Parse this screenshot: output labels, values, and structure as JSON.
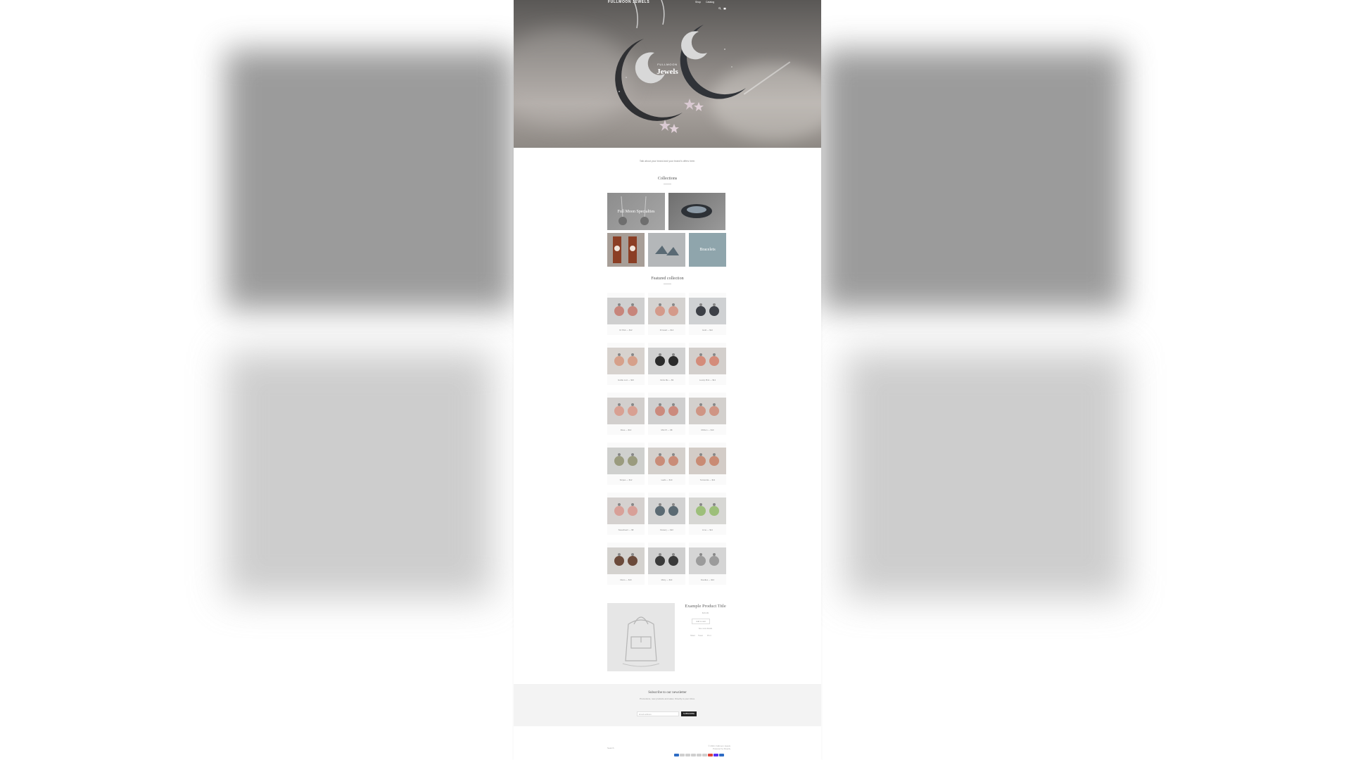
{
  "store": {
    "logo": "FULLMOON JEWELS",
    "nav_links": [
      "Shop",
      "Catalog"
    ],
    "hero_kicker": "FULLMOON",
    "hero_title": "Jewels",
    "intro_text": "Talk about your brand and your brand's offers here."
  },
  "collections": {
    "title": "Collections",
    "items": [
      "Full Moon Specialties",
      "",
      "",
      "",
      "Bracelets"
    ]
  },
  "featured": {
    "title": "Featured collection",
    "products": [
      {
        "name": "Dr Pink",
        "price": "$12"
      },
      {
        "name": "Dr Heart",
        "price": "$12"
      },
      {
        "name": "Gold",
        "price": "$12"
      },
      {
        "name": "Goldie Loci",
        "price": "$10"
      },
      {
        "name": "Circle Me",
        "price": "$9"
      },
      {
        "name": "Lovely Pink",
        "price": "$12"
      },
      {
        "name": "Rose",
        "price": "$12"
      },
      {
        "name": "Mini Pi",
        "price": "$8"
      },
      {
        "name": "Ribbon",
        "price": "$10"
      },
      {
        "name": "Stripes",
        "price": "$12"
      },
      {
        "name": "Leafs",
        "price": "$10"
      },
      {
        "name": "Terracotta",
        "price": "$12"
      },
      {
        "name": "Sweetheart",
        "price": "$8"
      },
      {
        "name": "Flowery",
        "price": "$10"
      },
      {
        "name": "Lime",
        "price": "$12"
      },
      {
        "name": "Disco",
        "price": "$10"
      },
      {
        "name": "Minty",
        "price": "$10"
      },
      {
        "name": "Doodles",
        "price": "$10"
      }
    ]
  },
  "example_product": {
    "title": "Example Product Title",
    "price": "$19.99",
    "button": "Add to cart",
    "more": "See more details",
    "share": [
      "Share",
      "Tweet",
      "Pin it"
    ]
  },
  "newsletter": {
    "title": "Subscribe to our newsletter",
    "subtitle": "Promotions, new products and sales. Directly to your inbox.",
    "placeholder": "Email address",
    "button": "SUBSCRIBE"
  },
  "footer": {
    "left": "Search",
    "right_lines": [
      "© 2024, Fullmoon Jewels",
      "Powered by Shopify"
    ],
    "payment_colors": [
      "#2d6cc4",
      "#cfcfcf",
      "#cfcfcf",
      "#cfcfcf",
      "#cfcfcf",
      "#cfcfcf",
      "#e0443a",
      "#5a31f4",
      "#2d6cc4"
    ]
  }
}
